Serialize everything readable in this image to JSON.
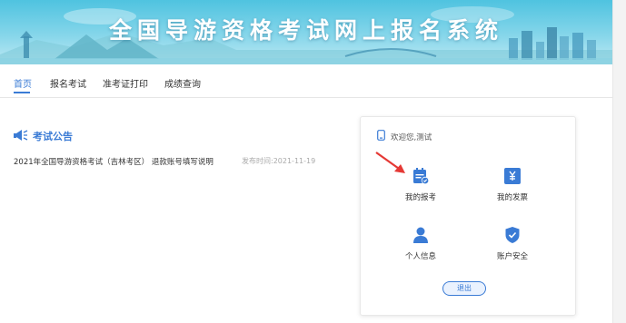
{
  "banner": {
    "title": "全国导游资格考试网上报名系统"
  },
  "nav": {
    "tabs": [
      "首页",
      "报名考试",
      "准考证打印",
      "成绩查询"
    ],
    "active_tab": "首页"
  },
  "announcement": {
    "title": "考试公告",
    "items": [
      {
        "text": "2021年全国导游资格考试（吉林考区） 退款账号填写说明",
        "date": "发布时间:2021-11-19"
      }
    ]
  },
  "user_card": {
    "welcome": "欢迎您,测试",
    "tiles": [
      {
        "label": "我的报考",
        "icon": "calendar-check-icon"
      },
      {
        "label": "我的发票",
        "icon": "invoice-icon"
      },
      {
        "label": "个人信息",
        "icon": "user-icon"
      },
      {
        "label": "账户安全",
        "icon": "shield-check-icon"
      }
    ],
    "logout": "退出"
  },
  "colors": {
    "accent": "#3a7bd5",
    "arrow": "#e53935",
    "banner": "#4fc3e0"
  }
}
